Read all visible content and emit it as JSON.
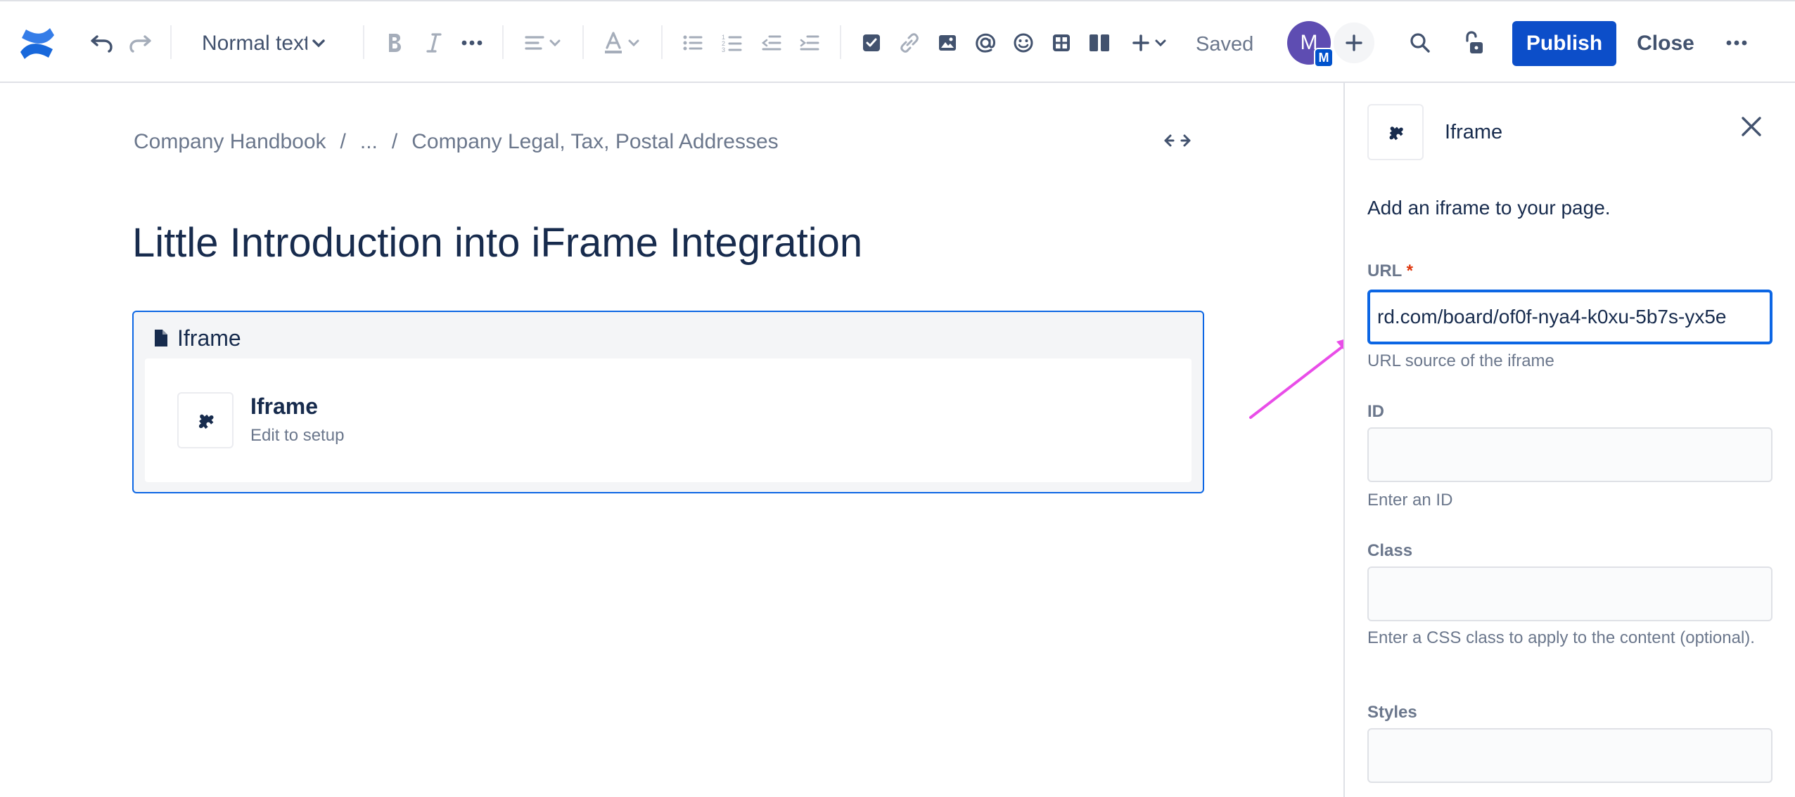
{
  "toolbar": {
    "text_style": "Normal text",
    "saved_label": "Saved",
    "avatar_initial": "M",
    "avatar_badge": "M",
    "publish_label": "Publish",
    "close_label": "Close",
    "icons": [
      "confluence-logo-icon",
      "undo-icon",
      "redo-icon",
      "chevron-down-icon",
      "bold-icon",
      "italic-icon",
      "more-formatting-icon",
      "align-icon",
      "text-color-icon",
      "bullet-list-icon",
      "numbered-list-icon",
      "outdent-icon",
      "indent-icon",
      "task-icon",
      "link-icon",
      "image-icon",
      "mention-icon",
      "emoji-icon",
      "table-icon",
      "layout-icon",
      "insert-icon",
      "search-icon",
      "restrictions-icon",
      "more-icon"
    ]
  },
  "breadcrumb": {
    "items": [
      "Company Handbook",
      "...",
      "Company Legal, Tax, Postal Addresses"
    ],
    "separator": "/"
  },
  "page": {
    "title": "Little Introduction into iFrame Integration"
  },
  "macro": {
    "header": "Iframe",
    "name": "Iframe",
    "subtitle": "Edit to setup"
  },
  "panel": {
    "title": "Iframe",
    "description": "Add an iframe to your page.",
    "fields": {
      "url": {
        "label": "URL",
        "required_mark": "*",
        "value": "rd.com/board/of0f-nya4-k0xu-5b7s-yx5e",
        "help": "URL source of the iframe"
      },
      "id": {
        "label": "ID",
        "value": "",
        "help": "Enter an ID"
      },
      "class": {
        "label": "Class",
        "value": "",
        "help": "Enter a CSS class to apply to the content (optional)."
      },
      "styles": {
        "label": "Styles",
        "value": ""
      }
    }
  },
  "colors": {
    "primary": "#0c4ec9",
    "focus": "#0c66e4",
    "text": "#172b4d",
    "subtle": "#6b778c",
    "avatar": "#5e4db2",
    "annotation_arrow": "#e94de8"
  }
}
